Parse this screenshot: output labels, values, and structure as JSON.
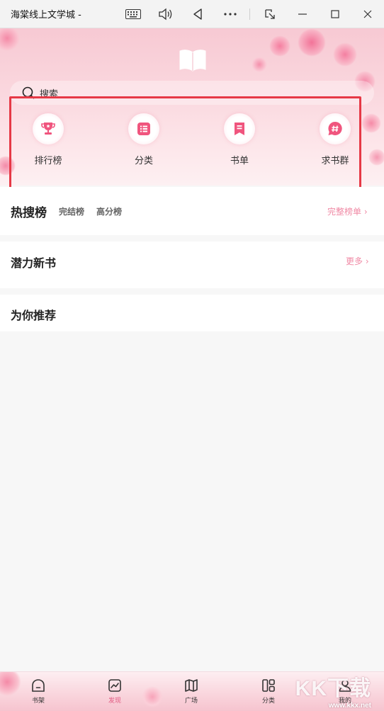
{
  "window": {
    "title": "海棠线上文学城 -",
    "buttons": [
      "keyboard-icon",
      "speaker-icon",
      "back-triangle-icon",
      "more-icon",
      "snap-icon",
      "minimize-icon",
      "maximize-icon",
      "close-icon"
    ]
  },
  "header": {
    "search_placeholder": "搜索",
    "quick_menu": [
      {
        "label": "排行榜",
        "icon": "trophy-icon"
      },
      {
        "label": "分类",
        "icon": "list-icon"
      },
      {
        "label": "书单",
        "icon": "bookmark-icon"
      },
      {
        "label": "求书群",
        "icon": "hashtag-chat-icon"
      }
    ],
    "highlight_color": "#e63946"
  },
  "hot_search": {
    "title": "热搜榜",
    "tabs": [
      "完结榜",
      "高分榜"
    ],
    "more_link": "完整榜单 ›"
  },
  "potential": {
    "title": "潜力新书",
    "more_link": "更多 ›"
  },
  "recommend": {
    "title": "为你推荐"
  },
  "bottom_nav": {
    "items": [
      {
        "label": "书架",
        "icon": "bookshelf-icon"
      },
      {
        "label": "发现",
        "icon": "discover-chart-icon",
        "active": true
      },
      {
        "label": "广场",
        "icon": "map-icon"
      },
      {
        "label": "分类",
        "icon": "category-icon"
      },
      {
        "label": "我的",
        "icon": "profile-icon"
      }
    ],
    "watermark": "KK下载",
    "watermark_url": "www.kkx.net"
  },
  "colors": {
    "accent": "#f08aa5",
    "active_nav": "#e25b83",
    "header_pink": "#f7c9d3"
  }
}
